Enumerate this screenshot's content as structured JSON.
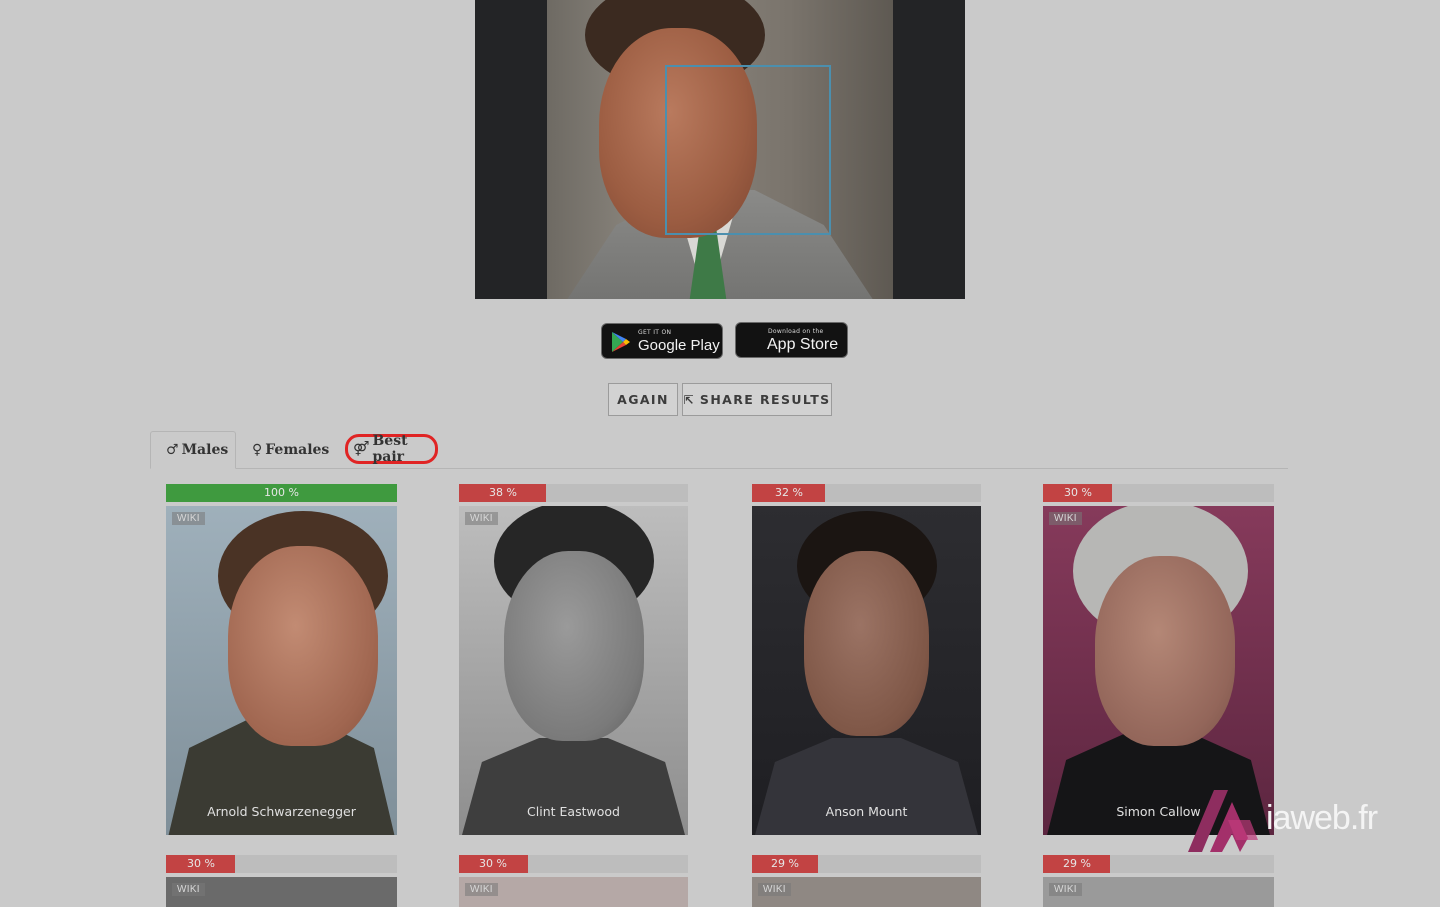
{
  "uploaded_photo": {
    "alt": "uploaded face photo"
  },
  "stores": {
    "google_play": {
      "small": "GET IT ON",
      "big": "Google Play"
    },
    "app_store": {
      "small": "Download on the",
      "big": "App Store"
    }
  },
  "actions": {
    "again": "AGAIN",
    "share": "SHARE RESULTS"
  },
  "tabs": {
    "males": {
      "symbol": "♂",
      "label": "Males"
    },
    "females": {
      "symbol": "♀",
      "label": "Females"
    },
    "best_pair": {
      "symbol": "⚤",
      "label": "Best pair"
    }
  },
  "results_row1": [
    {
      "name": "Arnold Schwarzenegger",
      "percent_label": "100 %",
      "percent": 100,
      "bar_color": "#3f9a3f",
      "wiki": "WIKI"
    },
    {
      "name": "Clint Eastwood",
      "percent_label": "38 %",
      "percent": 38,
      "bar_color": "#c24343",
      "wiki": "WIKI"
    },
    {
      "name": "Anson Mount",
      "percent_label": "32 %",
      "percent": 32,
      "bar_color": "#c24343"
    },
    {
      "name": "Simon Callow",
      "percent_label": "30 %",
      "percent": 30,
      "bar_color": "#c24343",
      "wiki": "WIKI"
    }
  ],
  "results_row2": [
    {
      "percent_label": "30 %",
      "percent": 30,
      "bar_color": "#c24343",
      "wiki": "WIKI"
    },
    {
      "percent_label": "30 %",
      "percent": 30,
      "bar_color": "#c24343",
      "wiki": "WIKI"
    },
    {
      "percent_label": "29 %",
      "percent": 29,
      "bar_color": "#c24343",
      "wiki": "WIKI"
    },
    {
      "percent_label": "29 %",
      "percent": 29,
      "bar_color": "#c24343",
      "wiki": "WIKI"
    }
  ],
  "watermark": {
    "text": "iaweb.fr"
  }
}
